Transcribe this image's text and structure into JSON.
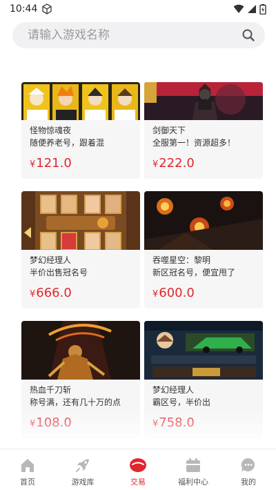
{
  "status_bar": {
    "time": "10:44"
  },
  "search": {
    "placeholder": "请输入游戏名称"
  },
  "listings": [
    {
      "title": "怪物惊魂夜",
      "desc": "随便养老号，跟着混",
      "currency": "¥",
      "price": "121.0"
    },
    {
      "title": "剑御天下",
      "desc": "全服第一！资源超多！",
      "currency": "¥",
      "price": "222.0"
    },
    {
      "title": "梦幻经理人",
      "desc": "半价出售冠名号",
      "currency": "¥",
      "price": "666.0"
    },
    {
      "title": "吞噬星空：黎明",
      "desc": "新区冠名号，便宜甩了",
      "currency": "¥",
      "price": "600.0"
    },
    {
      "title": "热血千刀斩",
      "desc": "称号满，还有几十万的点",
      "currency": "¥",
      "price": "108.0"
    },
    {
      "title": "梦幻经理人",
      "desc": "霸区号，半价出",
      "currency": "¥",
      "price": "758.0"
    }
  ],
  "nav": [
    {
      "label": "首页",
      "icon": "home-icon"
    },
    {
      "label": "游戏库",
      "icon": "rocket-icon"
    },
    {
      "label": "交易",
      "icon": "trade-icon",
      "active": true
    },
    {
      "label": "福利中心",
      "icon": "calendar-icon"
    },
    {
      "label": "我的",
      "icon": "chat-icon"
    }
  ],
  "colors": {
    "accent": "#e1262d",
    "card_bg": "#f6f6f6",
    "search_bg": "#f1f1f3"
  }
}
